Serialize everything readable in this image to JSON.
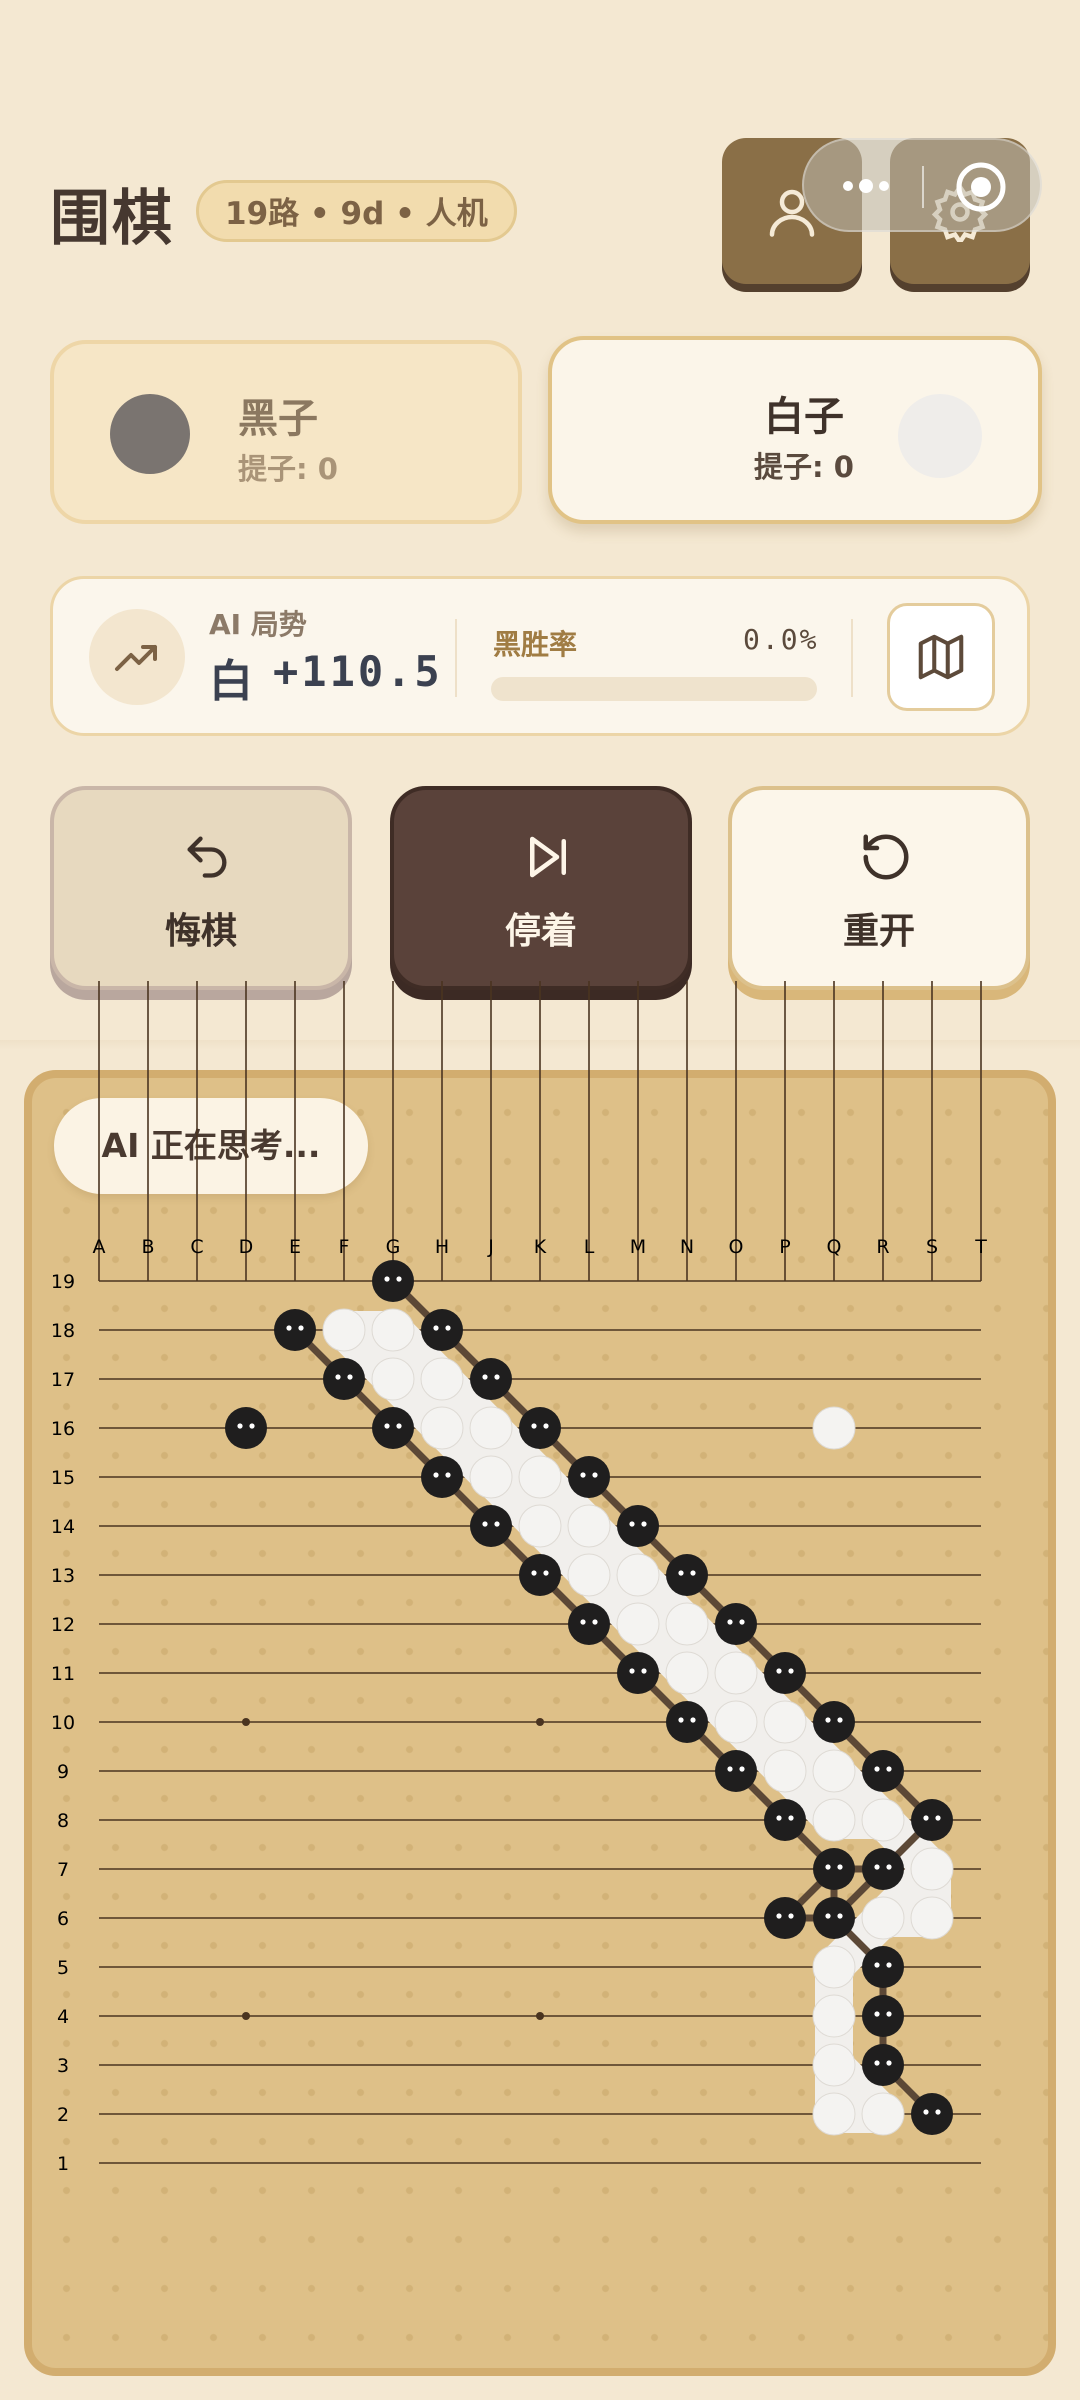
{
  "header": {
    "title": "围棋",
    "mode_badge": "19路 • 9d • 人机"
  },
  "players": {
    "black": {
      "name": "黑子",
      "captures": "提子: 0"
    },
    "white": {
      "name": "白子",
      "captures": "提子: 0"
    }
  },
  "analysis": {
    "label": "AI 局势",
    "leader": "白",
    "lead": "+110.5",
    "winrate_label": "黑胜率",
    "winrate_value": "0.0%",
    "winrate": 0.0
  },
  "actions": {
    "undo": "悔棋",
    "pass": "停着",
    "restart": "重开"
  },
  "status": {
    "thinking": "AI 正在思考..."
  },
  "board": {
    "size": 19,
    "columns": [
      "A",
      "B",
      "C",
      "D",
      "E",
      "F",
      "G",
      "H",
      "J",
      "K",
      "L",
      "M",
      "N",
      "O",
      "P",
      "Q",
      "R",
      "S",
      "T"
    ],
    "rows": [
      "19",
      "18",
      "17",
      "16",
      "15",
      "14",
      "13",
      "12",
      "11",
      "10",
      "9",
      "8",
      "7",
      "6",
      "5",
      "4",
      "3",
      "2",
      "1"
    ],
    "black_stones": [
      "E18",
      "F17",
      "D16",
      "G19",
      "H18",
      "J17",
      "K16",
      "L15",
      "M14",
      "N13",
      "O12",
      "P11",
      "Q10",
      "R9",
      "S8",
      "G16",
      "H15",
      "J14",
      "K13",
      "L12",
      "M11",
      "N10",
      "O9",
      "P8",
      "Q7",
      "R7",
      "P6",
      "Q6",
      "R5",
      "R4",
      "R3",
      "S2"
    ],
    "white_stones": [
      "F18",
      "G18",
      "G17",
      "H17",
      "H16",
      "J16",
      "J15",
      "K15",
      "K14",
      "L14",
      "L13",
      "M13",
      "M12",
      "N12",
      "N11",
      "O11",
      "O10",
      "P10",
      "P9",
      "Q9",
      "Q8",
      "R8",
      "S7",
      "S6",
      "R6",
      "Q5",
      "Q4",
      "Q3",
      "Q2",
      "R2",
      "Q16"
    ],
    "colors": {
      "black": "#1f1e1e",
      "white": "#f4f3f1",
      "line": "#4a3420",
      "link": "#5c4836"
    }
  }
}
